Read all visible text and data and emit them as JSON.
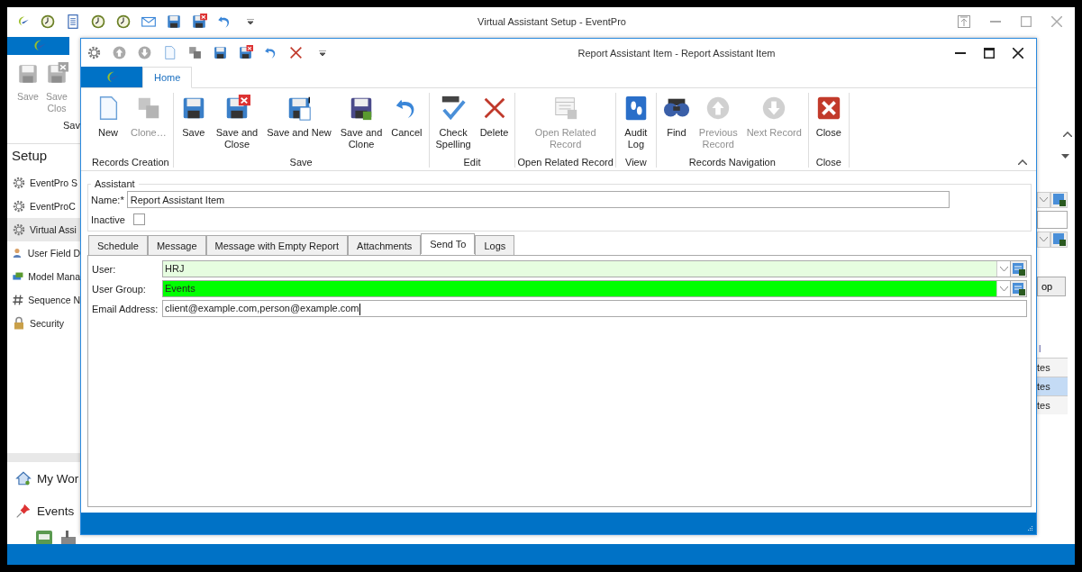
{
  "main_window": {
    "title": "Virtual Assistant Setup - EventPro",
    "ribbon_buttons": [
      {
        "lines": [
          "Save"
        ],
        "disabled": true,
        "kind": "save"
      },
      {
        "lines": [
          "Save",
          "Clos"
        ],
        "disabled": true,
        "kind": "saveclose"
      }
    ],
    "ribbon_group": "Sav",
    "sidebar": {
      "title": "Setup",
      "items": [
        {
          "label": "EventPro S",
          "kind": "gear",
          "selected": false
        },
        {
          "label": "EventProC",
          "kind": "gear",
          "selected": false
        },
        {
          "label": "Virtual Assi",
          "kind": "gear",
          "selected": true
        },
        {
          "label": "User Field D",
          "kind": "user",
          "selected": false
        },
        {
          "label": "Model Mana",
          "kind": "model",
          "selected": false
        },
        {
          "label": "Sequence N",
          "kind": "hash",
          "selected": false
        },
        {
          "label": "Security",
          "kind": "lock",
          "selected": false
        }
      ]
    },
    "nav": [
      {
        "label": "My Wor",
        "kind": "home"
      },
      {
        "label": "Events",
        "kind": "pin"
      }
    ],
    "right_panel": {
      "button": "op",
      "column_header": "l",
      "rows": [
        {
          "text": "tes",
          "selected": false
        },
        {
          "text": "tes",
          "selected": true
        },
        {
          "text": "tes",
          "selected": false
        }
      ]
    }
  },
  "dialog": {
    "title": "Report Assistant Item - Report Assistant Item",
    "tabs": [
      {
        "label": "Home",
        "selected": true
      }
    ],
    "ribbon_groups": [
      {
        "label": "Records Creation",
        "buttons": [
          {
            "lines": [
              "New"
            ],
            "kind": "new",
            "disabled": false
          },
          {
            "lines": [
              "Clone…"
            ],
            "kind": "clone",
            "disabled": true
          }
        ]
      },
      {
        "label": "Save",
        "buttons": [
          {
            "lines": [
              "Save"
            ],
            "kind": "save",
            "disabled": false
          },
          {
            "lines": [
              "Save and",
              "Close"
            ],
            "kind": "saveclose",
            "disabled": false
          },
          {
            "lines": [
              "Save and New"
            ],
            "kind": "savenew",
            "disabled": false
          },
          {
            "lines": [
              "Save and",
              "Clone"
            ],
            "kind": "saveclone",
            "disabled": false
          },
          {
            "lines": [
              "Cancel"
            ],
            "kind": "undo",
            "disabled": false
          }
        ]
      },
      {
        "label": "Edit",
        "buttons": [
          {
            "lines": [
              "Check",
              "Spelling"
            ],
            "kind": "spell",
            "disabled": false
          },
          {
            "lines": [
              "Delete"
            ],
            "kind": "delete",
            "disabled": false
          }
        ]
      },
      {
        "label": "Open Related Record",
        "buttons": [
          {
            "lines": [
              "Open Related",
              "Record"
            ],
            "kind": "related",
            "disabled": true
          }
        ]
      },
      {
        "label": "View",
        "buttons": [
          {
            "lines": [
              "Audit",
              "Log"
            ],
            "kind": "audit",
            "disabled": false
          }
        ]
      },
      {
        "label": "Records Navigation",
        "buttons": [
          {
            "lines": [
              "Find"
            ],
            "kind": "find",
            "disabled": false
          },
          {
            "lines": [
              "Previous",
              "Record"
            ],
            "kind": "up",
            "disabled": true
          },
          {
            "lines": [
              "Next Record"
            ],
            "kind": "down",
            "disabled": true
          }
        ]
      },
      {
        "label": "Close",
        "buttons": [
          {
            "lines": [
              "Close"
            ],
            "kind": "close",
            "disabled": false
          }
        ]
      }
    ],
    "assistant": {
      "legend": "Assistant",
      "name_label": "Name:*",
      "name_value": "Report Assistant Item",
      "inactive_label": "Inactive",
      "inactive": false
    },
    "form_tabs": [
      {
        "label": "Schedule",
        "selected": false
      },
      {
        "label": "Message",
        "selected": false
      },
      {
        "label": "Message with Empty Report",
        "selected": false
      },
      {
        "label": "Attachments",
        "selected": false
      },
      {
        "label": "Send To",
        "selected": true
      },
      {
        "label": "Logs",
        "selected": false
      }
    ],
    "fields": [
      {
        "label": "User:",
        "value": "HRJ",
        "kind": "combo",
        "color": "#e6fde0"
      },
      {
        "label": "User Group:",
        "value": "Events",
        "kind": "combo",
        "color": "#00ff00"
      },
      {
        "label": "Email Address:",
        "value": "client@example.com,person@example.com",
        "kind": "text"
      }
    ]
  }
}
